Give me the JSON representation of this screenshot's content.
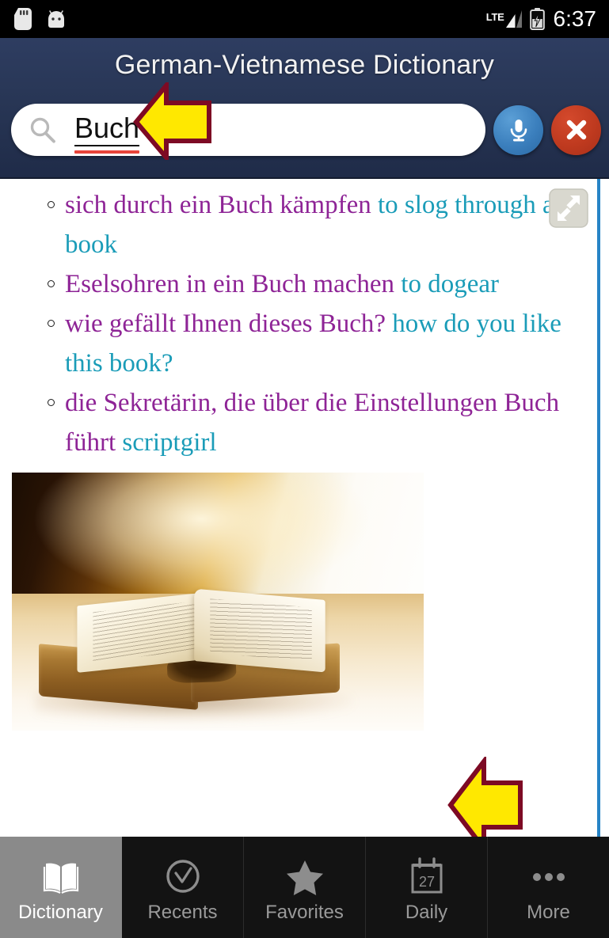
{
  "statusbar": {
    "sd_icon": "sd-card-icon",
    "android_icon": "android-robot-icon",
    "network_label": "LTE",
    "signal_icon": "signal-bars-icon",
    "battery_icon": "battery-charging-icon",
    "time": "6:37"
  },
  "header": {
    "title": "German-Vietnamese Dictionary",
    "background_color": "#283655",
    "search": {
      "value": "Buch",
      "placeholder": "",
      "search_icon": "search-magnifier-icon",
      "mic_icon": "microphone-icon",
      "mic_color": "#3b7fbd",
      "clear_icon": "close-x-icon",
      "clear_color": "#bf3a1f"
    }
  },
  "content": {
    "expand_icon": "expand-fullscreen-icon",
    "german_color": "#8e2496",
    "english_color": "#1a9cb8",
    "scrollbar_color": "#2684c6",
    "entries": [
      {
        "de": "sich durch ein Buch kämpfen ",
        "en": "to slog through a book"
      },
      {
        "de": "Eselsohren in ein Buch machen ",
        "en": "to dogear"
      },
      {
        "de": "wie gefällt Ihnen dieses Buch? ",
        "en": "how do you like this book?"
      },
      {
        "de": "die Sekretärin, die über die Einstellungen Buch führt ",
        "en": "scriptgirl"
      }
    ],
    "photo": {
      "name": "open-antique-book-photo",
      "description": "Open antique book on wooden table with warm golden light"
    },
    "annotations": [
      {
        "name": "arrow-pointing-to-search-field",
        "direction": "left",
        "fill": "#ffe800",
        "stroke": "#7d0a24"
      },
      {
        "name": "arrow-pointing-to-photo",
        "direction": "left",
        "fill": "#ffe800",
        "stroke": "#7d0a24"
      }
    ]
  },
  "bottomnav": {
    "items": [
      {
        "label": "Dictionary",
        "icon": "open-book-icon",
        "active": true
      },
      {
        "label": "Recents",
        "icon": "clock-check-circle-icon",
        "active": false
      },
      {
        "label": "Favorites",
        "icon": "star-icon",
        "active": false
      },
      {
        "label": "Daily",
        "icon": "calendar-icon",
        "day": "27",
        "active": false
      },
      {
        "label": "More",
        "icon": "ellipsis-icon",
        "active": false
      }
    ]
  }
}
